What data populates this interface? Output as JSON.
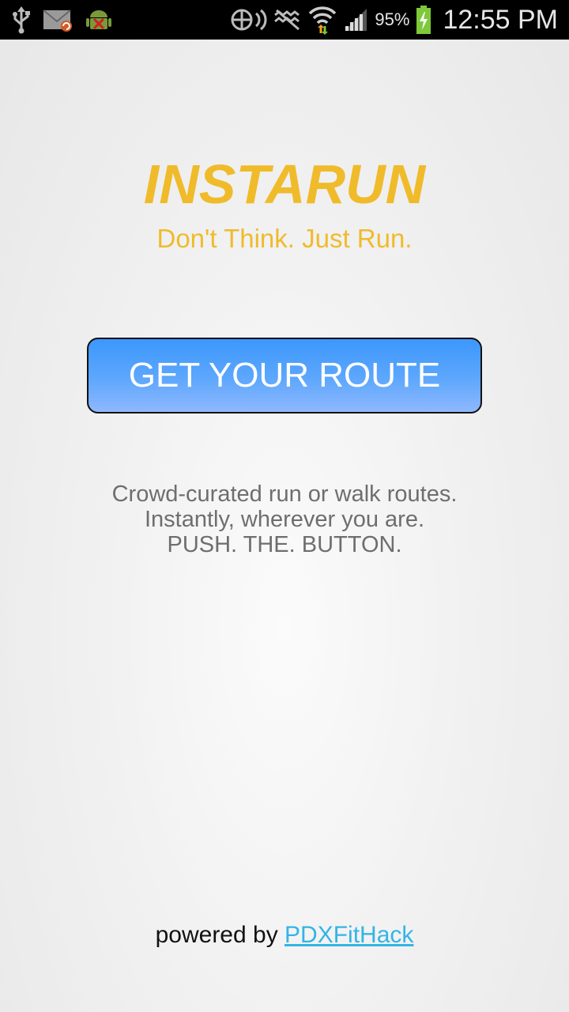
{
  "status_bar": {
    "left_icons": [
      "usb-icon",
      "email-sync-icon",
      "android-debug-icon"
    ],
    "right_icons": [
      "nfc-icon",
      "vibrate-icon",
      "wifi-icon",
      "signal-icon",
      "battery-charging-icon"
    ],
    "battery_percent": "95%",
    "time": "12:55 PM"
  },
  "app": {
    "title": "INSTARUN",
    "tagline": "Don't Think. Just Run."
  },
  "cta": {
    "label": "GET YOUR ROUTE"
  },
  "description": {
    "line1": "Crowd-curated run or walk routes.",
    "line2": "Instantly, wherever you are.",
    "line3": "PUSH. THE. BUTTON."
  },
  "footer": {
    "prefix": "powered by",
    "link_text": "PDXFitHack"
  },
  "colors": {
    "accent": "#f0bb2a",
    "button_top": "#3c97fc",
    "button_bottom": "#8fb8fe",
    "link": "#33b5e5"
  }
}
